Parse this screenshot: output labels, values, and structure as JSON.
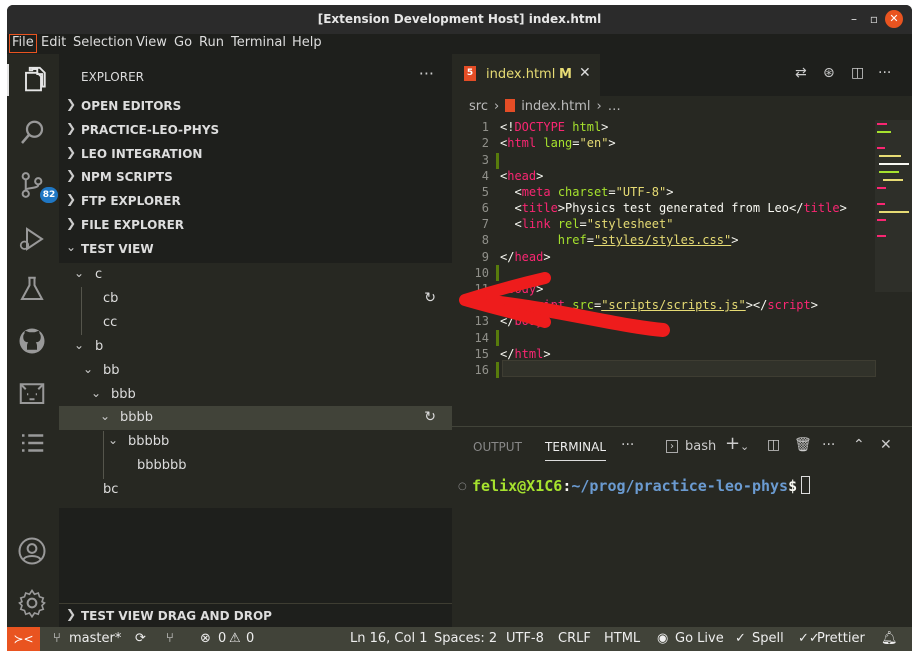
{
  "window": {
    "title": "[Extension Development Host] index.html"
  },
  "menu": [
    "File",
    "Edit",
    "Selection",
    "View",
    "Go",
    "Run",
    "Terminal",
    "Help"
  ],
  "activity": {
    "scm_badge": "82"
  },
  "sidebar": {
    "title": "EXPLORER",
    "sections": [
      "OPEN EDITORS",
      "PRACTICE-LEO-PHYS",
      "LEO INTEGRATION",
      "NPM SCRIPTS",
      "FTP EXPLORER",
      "FILE EXPLORER",
      "TEST VIEW"
    ],
    "tree": [
      "c",
      "cb",
      "cc",
      "b",
      "bb",
      "bbb",
      "bbbb",
      "bbbbb",
      "bbbbbb",
      "bc"
    ],
    "bottom_section": "TEST VIEW DRAG AND DROP"
  },
  "editor": {
    "tab": {
      "name": "index.html",
      "modified": "M"
    },
    "breadcrumb": {
      "folder": "src",
      "file": "index.html",
      "more": "…"
    },
    "line_numbers": [
      "1",
      "2",
      "3",
      "4",
      "5",
      "6",
      "7",
      "8",
      "9",
      "10",
      "11",
      "12",
      "13",
      "14",
      "15",
      "16"
    ]
  },
  "panel": {
    "tabs": [
      "OUTPUT",
      "TERMINAL"
    ],
    "shell": "bash",
    "prompt_user": "felix@X1C6",
    "prompt_path": "~/prog/practice-leo-phys",
    "prompt_symbol": "$"
  },
  "status": {
    "branch": "master*",
    "errors": "0",
    "warnings": "0",
    "position": "Ln 16, Col 1",
    "spaces": "Spaces: 2",
    "encoding": "UTF-8",
    "eol": "CRLF",
    "language": "HTML",
    "go_live": "Go Live",
    "spell": "Spell",
    "prettier": "Prettier"
  },
  "colors": {
    "accent": "#e95420",
    "selection": "#414339",
    "keyword": "#f92672",
    "attr": "#a6e22e",
    "string": "#e6db74"
  }
}
